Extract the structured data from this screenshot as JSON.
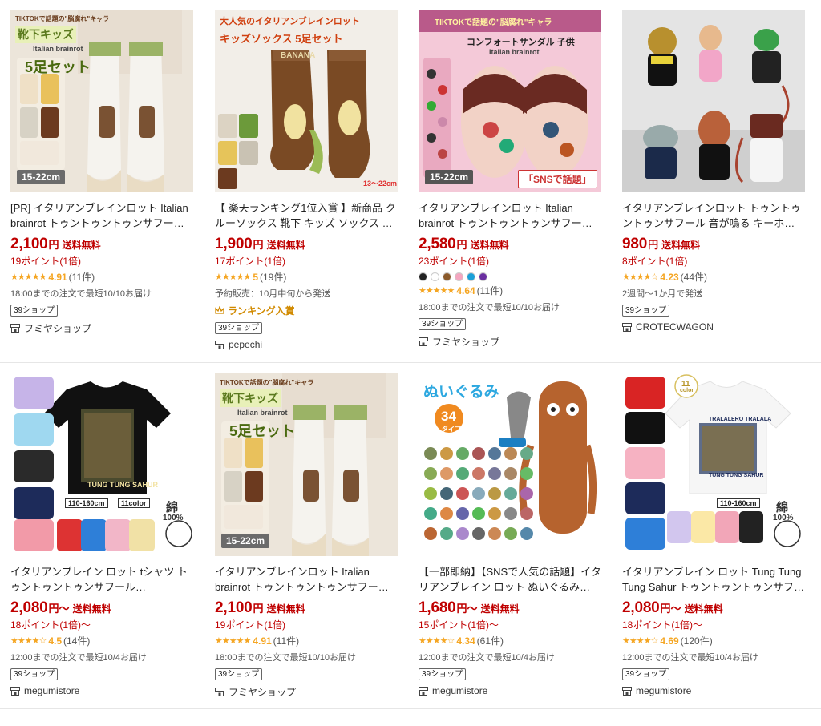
{
  "colors": {
    "price": "#bf0000",
    "star": "#f5a623",
    "ranking": "#d18a00"
  },
  "products": [
    {
      "title": "[PR] イタリアンブレインロット Italian brainrot トゥントゥントゥンサフール…",
      "price": "2,100",
      "yen": "円",
      "price_suffix": "",
      "shipping": "送料無料",
      "points": "19ポイント(1倍)",
      "stars": "★★★★★",
      "rating": "4.91",
      "review_count": "(11件)",
      "delivery": "18:00までの注文で最短10/10お届け",
      "badge": "39ショップ",
      "shop": "フミヤショップ",
      "image": {
        "top_label": "TIKTOKで話題の\"脳腐れ\"キャラ",
        "headline": "靴下キッズ",
        "sub": "Italian brainrot",
        "set": "5足セット",
        "size": "15-22cm"
      }
    },
    {
      "title": "【 楽天ランキング1位入賞 】新商品 クルーソックス 靴下 キッズ ソックス スポーツ …",
      "price": "1,900",
      "yen": "円",
      "price_suffix": "",
      "shipping": "送料無料",
      "points": "17ポイント(1倍)",
      "stars": "★★★★★",
      "rating": "5",
      "review_count": "(19件)",
      "delivery": "予約販売：10月中旬から発送",
      "ranking": "ランキング入賞",
      "badge": "39ショップ",
      "shop": "pepechi",
      "image": {
        "line1": "大人気のイタリアンブレインロット",
        "line2": "キッズソックス 5足セット",
        "banana": "BANANA",
        "size": "13〜22cm"
      }
    },
    {
      "title": "イタリアンブレインロット Italian brainrot トゥントゥントゥンサフール…",
      "price": "2,580",
      "yen": "円",
      "price_suffix": "",
      "shipping": "送料無料",
      "points": "23ポイント(1倍)",
      "swatches": [
        "#222222",
        "#ffffff",
        "#8b5a2b",
        "#f4a6c0",
        "#1aa0d8",
        "#6a2fa0"
      ],
      "stars": "★★★★★",
      "rating": "4.64",
      "review_count": "(11件)",
      "delivery": "18:00までの注文で最短10/10お届け",
      "badge": "39ショップ",
      "shop": "フミヤショップ",
      "image": {
        "top_label": "TIKTOKで話題の\"脳腐れ\"キャラ",
        "headline": "コンフォートサンダル 子供",
        "sub": "Italian brainrot",
        "size": "15-22cm",
        "tag": "「SNSで話題」"
      }
    },
    {
      "title": "イタリアンブレインロット トゥントゥントゥンサフール 音が鳴る キーホルダー おも…",
      "price": "980",
      "yen": "円",
      "price_suffix": "",
      "shipping": "送料無料",
      "points": "8ポイント(1倍)",
      "stars": "★★★★☆",
      "rating": "4.23",
      "review_count": "(44件)",
      "delivery": "2週間〜1か月で発送",
      "badge": "39ショップ",
      "shop": "CROTECWAGON",
      "image": {}
    },
    {
      "title": "イタリアンブレイン ロット tシャツ トゥントゥントゥンサフール…",
      "price": "2,080",
      "yen": "円〜",
      "price_suffix": "",
      "shipping": "送料無料",
      "points": "18ポイント(1倍)〜",
      "stars": "★★★★☆",
      "rating": "4.5",
      "review_count": "(14件)",
      "delivery": "12:00までの注文で最短10/4お届け",
      "badge": "39ショップ",
      "shop": "megumistore",
      "image": {
        "shirt_text": "TUNG TUNG SAHUR",
        "size": "110-160cm",
        "colors": "11color",
        "cotton": "綿",
        "pct": "100%"
      }
    },
    {
      "title": "イタリアンブレインロット Italian brainrot トゥントゥントゥンサフール…",
      "price": "2,100",
      "yen": "円",
      "price_suffix": "",
      "shipping": "送料無料",
      "points": "19ポイント(1倍)",
      "stars": "★★★★★",
      "rating": "4.91",
      "review_count": "(11件)",
      "delivery": "18:00までの注文で最短10/10お届け",
      "badge": "39ショップ",
      "shop": "フミヤショップ",
      "image": {
        "top_label": "TIKTOKで話題の\"脳腐れ\"キャラ",
        "headline": "靴下キッズ",
        "sub": "Italian brainrot",
        "set": "5足セット",
        "size": "15-22cm"
      }
    },
    {
      "title": "【一部即納】【SNSで人気の話題】イタリアンブレイン ロット ぬいぐるみ Italian…",
      "price": "1,680",
      "yen": "円〜",
      "price_suffix": "",
      "shipping": "送料無料",
      "points": "15ポイント(1倍)〜",
      "stars": "★★★★☆",
      "rating": "4.34",
      "review_count": "(61件)",
      "delivery": "12:00までの注文で最短10/4お届け",
      "badge": "39ショップ",
      "shop": "megumistore",
      "image": {
        "headline": "ぬいぐるみ",
        "num": "34",
        "unit": "タイプ"
      }
    },
    {
      "title": "イタリアンブレイン ロット Tung Tung Tung Sahur トゥントゥントゥンサフール…",
      "price": "2,080",
      "yen": "円〜",
      "price_suffix": "",
      "shipping": "送料無料",
      "points": "18ポイント(1倍)〜",
      "stars": "★★★★☆",
      "rating": "4.69",
      "review_count": "(120件)",
      "delivery": "12:00までの注文で最短10/4お届け",
      "badge": "39ショップ",
      "shop": "megumistore",
      "image": {
        "shirt_text": "TRALALERO TRALALA",
        "shirt_text2": "TUNG TUNG SAHUR",
        "size": "110-160cm",
        "colors_num": "11",
        "colors_word": "color",
        "cotton": "綿",
        "pct": "100%"
      }
    }
  ]
}
